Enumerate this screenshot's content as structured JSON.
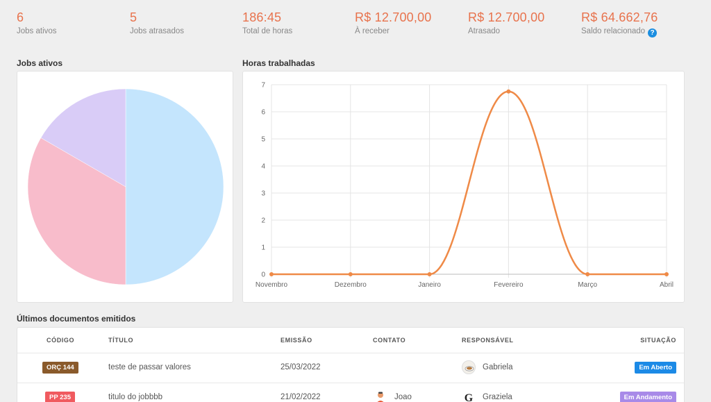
{
  "stats": [
    {
      "value": "6",
      "label": "Jobs ativos"
    },
    {
      "value": "5",
      "label": "Jobs atrasados"
    },
    {
      "value": "186:45",
      "label": "Total de horas"
    },
    {
      "value": "R$ 12.700,00",
      "label": "À receber"
    },
    {
      "value": "R$ 12.700,00",
      "label": "Atrasado"
    },
    {
      "value": "R$ 64.662,76",
      "label": "Saldo relacionado",
      "help_icon": "question-circle-icon"
    }
  ],
  "sections": {
    "jobs_ativos": "Jobs ativos",
    "horas_trabalhadas": "Horas trabalhadas",
    "ultimos_documentos": "Últimos documentos emitidos"
  },
  "chart_data": [
    {
      "type": "pie",
      "slices": [
        {
          "value": 3,
          "color": "#c4e5fd"
        },
        {
          "value": 2,
          "color": "#f8bccb"
        },
        {
          "value": 1,
          "color": "#d9ccf7"
        }
      ]
    },
    {
      "type": "line",
      "categories": [
        "Novembro",
        "Dezembro",
        "Janeiro",
        "Fevereiro",
        "Março",
        "Abril"
      ],
      "series": [
        {
          "values": [
            0,
            0,
            0,
            6.75,
            0,
            0
          ],
          "color": "#ef8a47"
        }
      ],
      "ylim": [
        0,
        7
      ],
      "yticks": [
        0,
        1,
        2,
        3,
        4,
        5,
        6,
        7
      ],
      "grid": true
    }
  ],
  "table": {
    "headers": {
      "codigo": "CÓDIGO",
      "titulo": "TÍTULO",
      "emissao": "EMISSÃO",
      "contato": "CONTATO",
      "responsavel": "RESPONSÁVEL",
      "situacao": "SITUAÇÃO"
    },
    "rows": [
      {
        "codigo": "ORÇ 144",
        "codigo_color": "#8a5a2b",
        "titulo": "teste de passar valores",
        "emissao": "25/03/2022",
        "contato": "",
        "responsavel": "Gabriela",
        "responsavel_icon": "coffee-avatar-icon",
        "situacao": "Em Aberto",
        "situacao_color": "#1c8ae6"
      },
      {
        "codigo": "PP 235",
        "codigo_color": "#f05a5f",
        "titulo": "titulo do jobbbb",
        "emissao": "21/02/2022",
        "contato": "Joao",
        "contato_icon": "person-avatar-icon",
        "responsavel": "Graziela",
        "responsavel_icon": "google-avatar-icon",
        "situacao": "Em Andamento",
        "situacao_color": "#a88ae8"
      }
    ]
  }
}
